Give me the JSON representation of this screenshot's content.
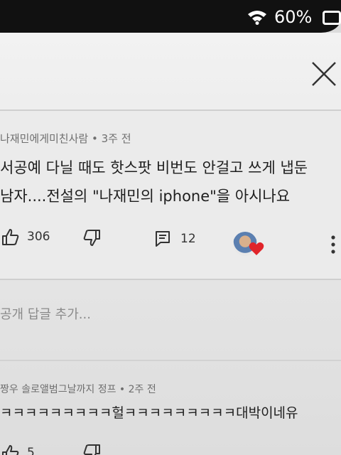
{
  "status": {
    "battery": "60%",
    "icons": [
      "wifi-icon",
      "battery-icon"
    ]
  },
  "header": {
    "icons": [
      "close-icon"
    ]
  },
  "comment": {
    "author": "나재민에게미친사람",
    "time": "3주 전",
    "body_line1": "서공예 다닐 때도 핫스팟 비번도 안걸고 쓰게 냅둔",
    "body_line2": "남자....전설의 \"나재민의 iphone\"을 아시나요",
    "likes": "306",
    "replies": "12",
    "icons": [
      "thumbs-up-icon",
      "thumbs-down-icon",
      "reply-icon",
      "heart-icon",
      "more-icon"
    ]
  },
  "add_reply": {
    "placeholder": "공개 답글 추가..."
  },
  "reply": {
    "author": "짱우 솔로앨범그날까지 정프",
    "time": "2주 전",
    "body": "ㅋㅋㅋㅋㅋㅋㅋㅋㅋ헐ㅋㅋㅋㅋㅋㅋㅋㅋㅋ대박이네유",
    "likes": "5"
  },
  "colors": {
    "heart": "#e0242a",
    "status_bar": "#111111"
  }
}
